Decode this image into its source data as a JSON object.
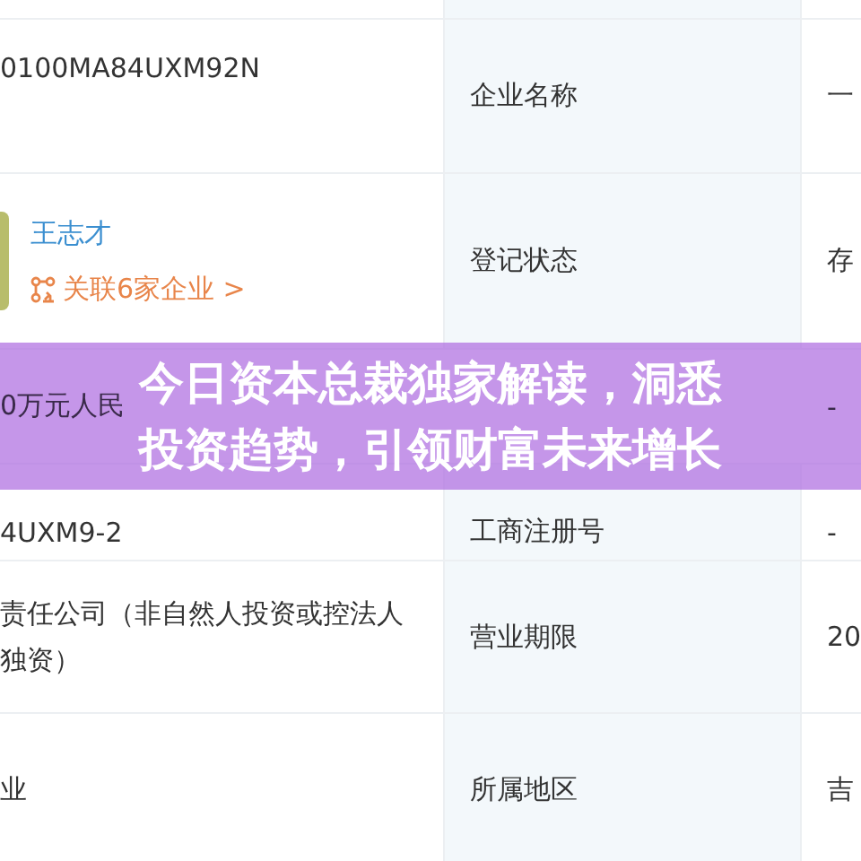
{
  "rows": [
    {
      "kind": "text",
      "value": "0100MA84UXM92N",
      "label": "企业名称",
      "extra": "一"
    },
    {
      "kind": "person",
      "name": "王志才",
      "link": "关联6家企业 >",
      "label": "登记状态",
      "extra": "存"
    },
    {
      "kind": "text",
      "value": "0万元人民",
      "extra": "-"
    },
    {
      "kind": "text",
      "value": "4UXM9-2",
      "label": "工商注册号",
      "extra": "-"
    },
    {
      "kind": "text",
      "value": "责任公司（非自然人投资或控法人独资）",
      "label": "营业期限",
      "extra": "20"
    },
    {
      "kind": "text",
      "value": "业",
      "label": "所属地区",
      "extra": "吉"
    }
  ],
  "banner": {
    "title": "今日资本总裁独家解读，洞悉投资趋势，引领财富未来增长"
  }
}
